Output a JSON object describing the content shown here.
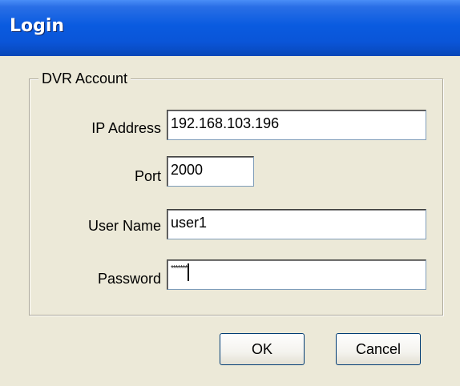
{
  "window": {
    "title": "Login"
  },
  "group": {
    "legend": "DVR Account"
  },
  "fields": {
    "ip_label": "IP Address",
    "ip_value": "192.168.103.196",
    "port_label": "Port",
    "port_value": "2000",
    "user_label": "User Name",
    "user_value": "user1",
    "password_label": "Password",
    "password_value": "*******"
  },
  "buttons": {
    "ok": "OK",
    "cancel": "Cancel"
  },
  "colors": {
    "titlebar": "#0a5be0",
    "dialog_bg": "#ece9d8"
  }
}
